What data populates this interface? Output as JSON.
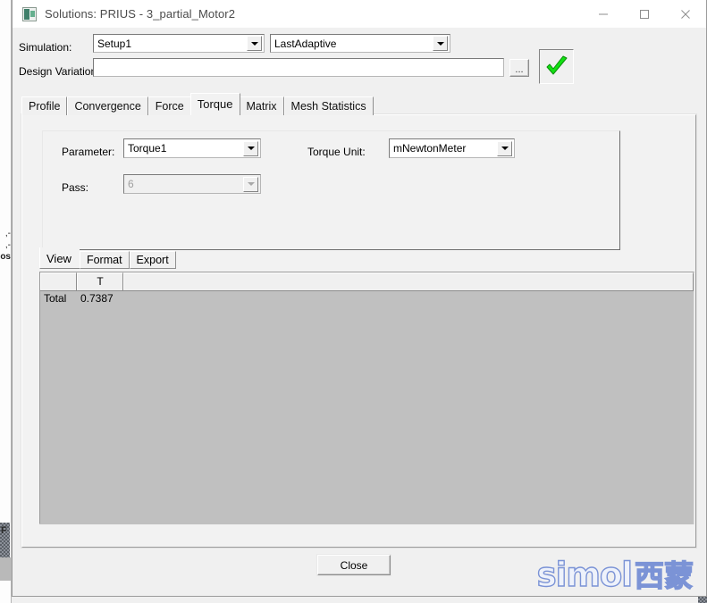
{
  "window": {
    "title": "Solutions: PRIUS - 3_partial_Motor2",
    "icon": "application-icon",
    "minimize_label": "–",
    "maximize_label": "□",
    "close_label": "✕"
  },
  "form": {
    "simulation_label": "Simulation:",
    "simulation_value": "Setup1",
    "adaptive_value": "LastAdaptive",
    "design_variation_label": "Design Variation:",
    "design_variation_value": "",
    "browse_label": "...",
    "validate_icon": "green-check-icon",
    "validate_color": "#00cc22"
  },
  "tabs": [
    {
      "label": "Profile",
      "active": false
    },
    {
      "label": "Convergence",
      "active": false
    },
    {
      "label": "Force",
      "active": false
    },
    {
      "label": "Torque",
      "active": true
    },
    {
      "label": "Matrix",
      "active": false
    },
    {
      "label": "Mesh Statistics",
      "active": false
    }
  ],
  "torque_panel": {
    "parameter_label": "Parameter:",
    "parameter_value": "Torque1",
    "torque_unit_label": "Torque Unit:",
    "torque_unit_value": "mNewtonMeter",
    "pass_label": "Pass:",
    "pass_value": "6",
    "pass_disabled": true
  },
  "subtabs": [
    {
      "label": "View",
      "active": true
    },
    {
      "label": "Format",
      "active": false
    },
    {
      "label": "Export",
      "active": false
    }
  ],
  "grid": {
    "headers": [
      "",
      "T",
      ""
    ],
    "rows": [
      {
        "name": "Total",
        "value": "0.7387",
        "extra": ""
      }
    ]
  },
  "footer": {
    "close_label": "Close"
  },
  "watermark": {
    "latin": "simol",
    "cjk": "西蒙",
    "color": "#7b93d6"
  },
  "background": {
    "fragments": [
      "-,",
      "-,",
      "os"
    ],
    "corner_letter": "F"
  }
}
